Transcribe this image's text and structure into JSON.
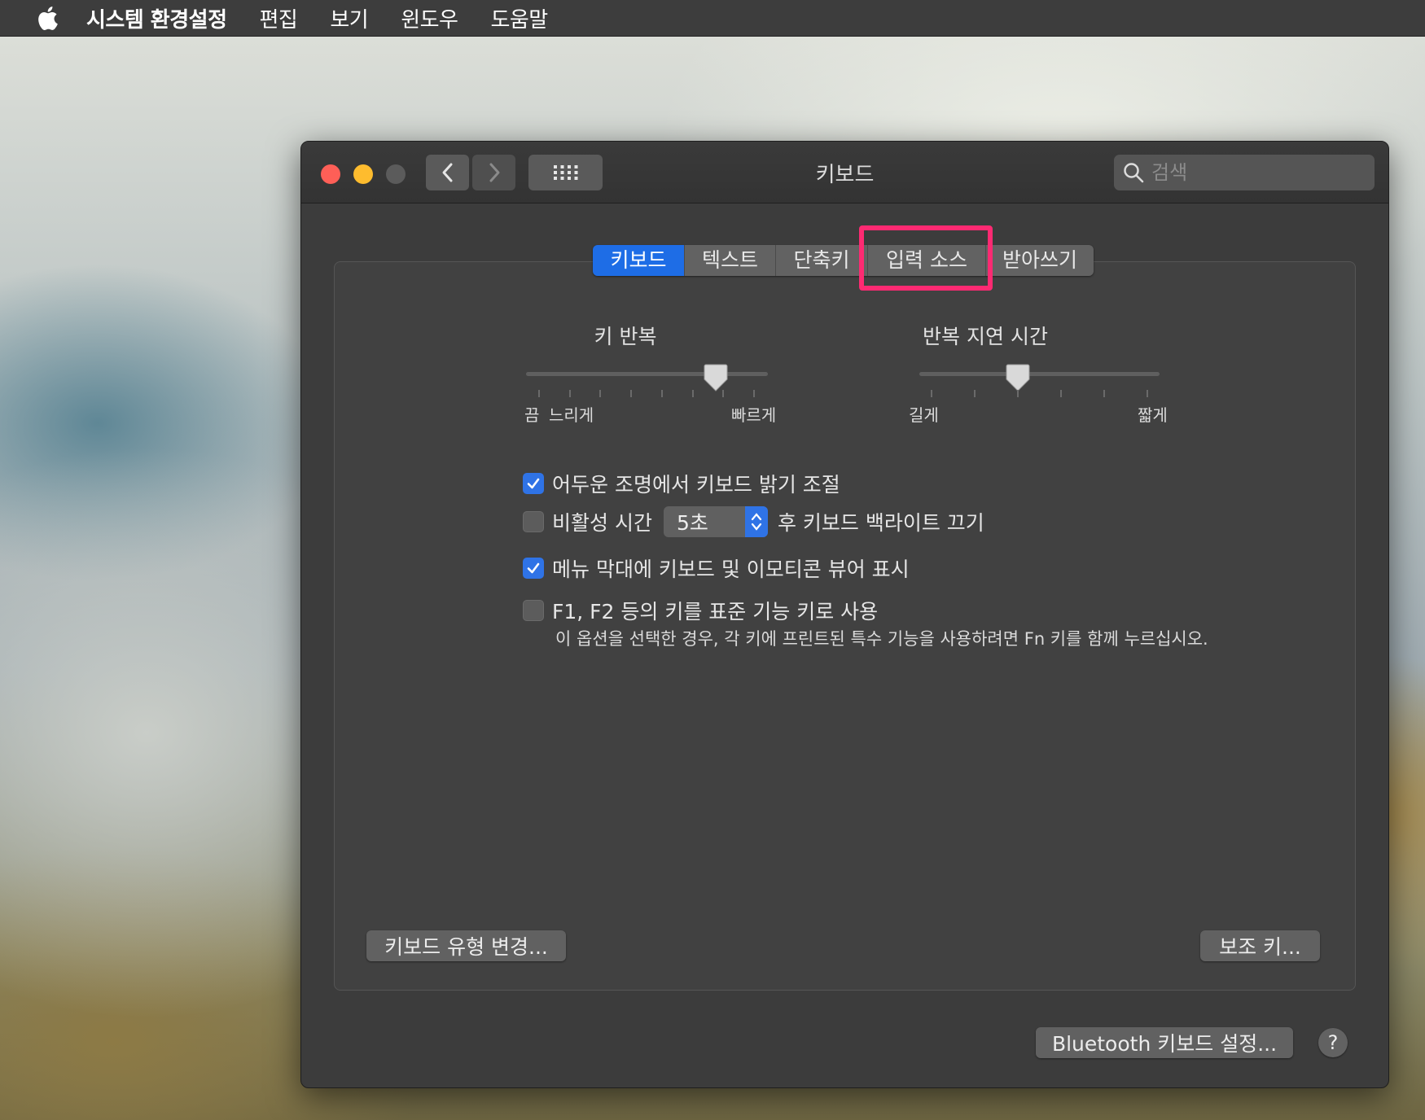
{
  "menubar": {
    "apple_icon": "apple-logo-icon",
    "items": [
      "시스템 환경설정",
      "편집",
      "보기",
      "윈도우",
      "도움말"
    ]
  },
  "window": {
    "title": "키보드",
    "search": {
      "placeholder": "검색",
      "value": ""
    },
    "nav": {
      "back_icon": "chevron-left-icon",
      "forward_icon": "chevron-right-icon",
      "grid_icon": "grid-icon"
    }
  },
  "tabs": [
    {
      "label": "키보드",
      "active": true
    },
    {
      "label": "텍스트",
      "active": false
    },
    {
      "label": "단축키",
      "active": false
    },
    {
      "label": "입력 소스",
      "active": false,
      "highlighted": true
    },
    {
      "label": "받아쓰기",
      "active": false
    }
  ],
  "key_repeat": {
    "title": "키 반복",
    "labels": {
      "off": "끔",
      "slow": "느리게",
      "fast": "빠르게"
    },
    "ticks": 8,
    "value_position": 0.82
  },
  "repeat_delay": {
    "title": "반복 지연 시간",
    "labels": {
      "long": "길게",
      "short": "짧게"
    },
    "ticks": 6,
    "value_position": 0.4
  },
  "options": {
    "adjust_brightness": {
      "label": "어두운 조명에서 키보드 밝기 조절",
      "checked": true
    },
    "backlight_off": {
      "label_before": "비활성 시간",
      "stepper_value": "5초",
      "label_after": "후 키보드 백라이트 끄기",
      "checked": false
    },
    "show_viewers": {
      "label": "메뉴 막대에 키보드 및 이모티콘 뷰어 표시",
      "checked": true
    },
    "fn_keys": {
      "label": "F1, F2 등의 키를 표준 기능 키로 사용",
      "checked": false,
      "note": "이 옵션을 선택한 경우, 각 키에 프린트된 특수 기능을 사용하려면 Fn 키를 함께 누르십시오."
    }
  },
  "buttons": {
    "change_type": "키보드 유형 변경...",
    "modifier": "보조 키...",
    "bluetooth": "Bluetooth 키보드 설정...",
    "help": "?"
  },
  "colors": {
    "accent": "#2f73e6",
    "highlight": "#fd2a72",
    "window_bg": "#3c3c3c"
  }
}
